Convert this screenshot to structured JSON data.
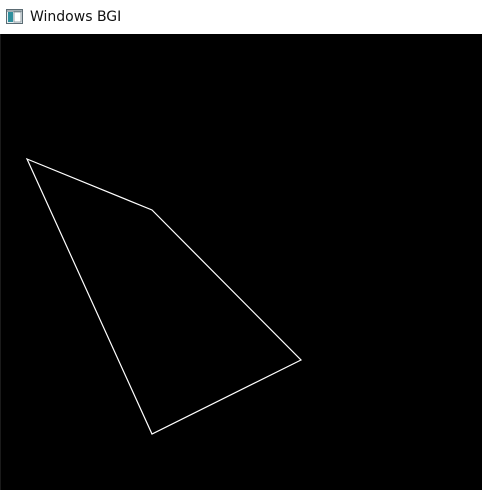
{
  "window": {
    "title": "Windows BGI",
    "icon": "bgi-window-icon"
  },
  "canvas": {
    "background_color": "#000000",
    "stroke_color": "#ffffff",
    "shapes": [
      {
        "type": "polygon",
        "name": "quadrilateral",
        "vertex_count": 4
      }
    ]
  }
}
